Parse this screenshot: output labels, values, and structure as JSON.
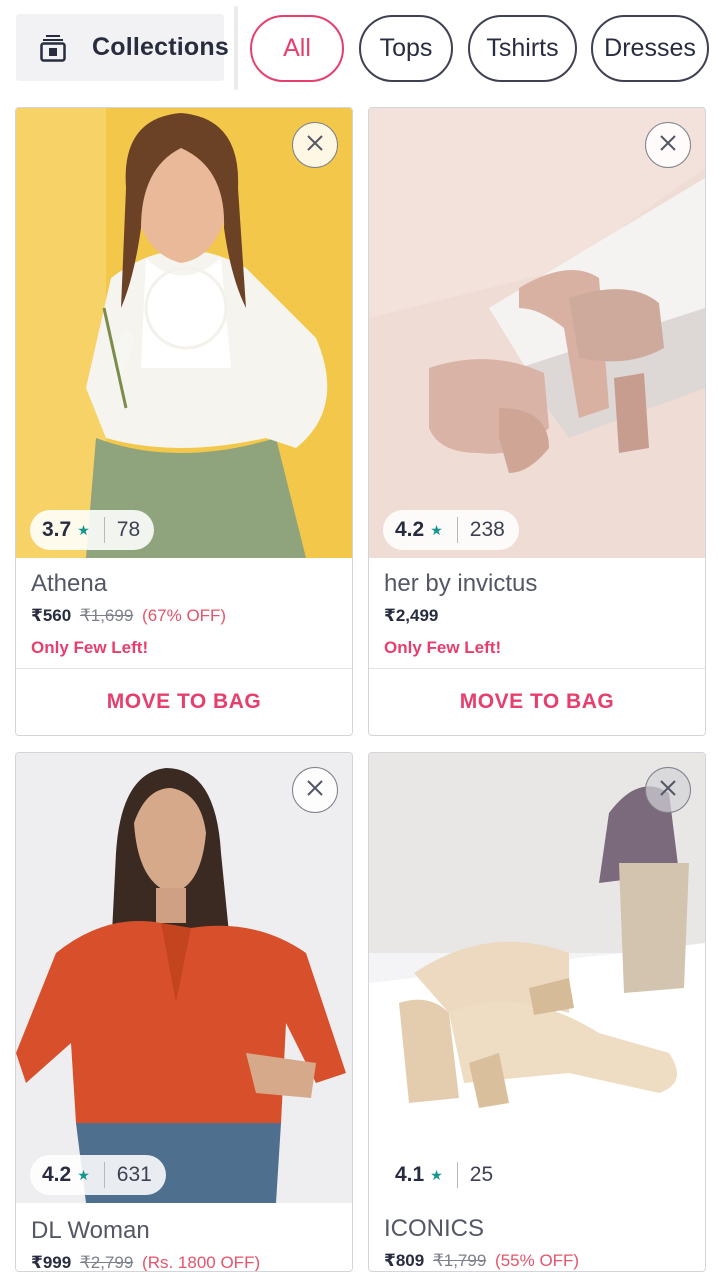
{
  "header": {
    "collections_label": "Collections",
    "filters": [
      {
        "label": "All",
        "active": true
      },
      {
        "label": "Tops",
        "active": false
      },
      {
        "label": "Tshirts",
        "active": false
      },
      {
        "label": "Dresses",
        "active": false
      }
    ]
  },
  "products": [
    {
      "brand": "Athena",
      "rating": "3.7",
      "rating_count": "78",
      "price": "₹560",
      "mrp": "₹1,699",
      "discount": "(67% OFF)",
      "stock": "Only Few Left!",
      "action": "MOVE TO BAG",
      "image": "woman-white-lace-top"
    },
    {
      "brand": "her by invictus",
      "rating": "4.2",
      "rating_count": "238",
      "price": "₹2,499",
      "mrp": "",
      "discount": "",
      "stock": "Only Few Left!",
      "action": "MOVE TO BAG",
      "image": "nude-block-heel-sandals"
    },
    {
      "brand": "DL Woman",
      "rating": "4.2",
      "rating_count": "631",
      "price": "₹999",
      "mrp": "₹2,799",
      "discount": "(Rs. 1800 OFF)",
      "stock": "",
      "action": "",
      "image": "woman-orange-shirt"
    },
    {
      "brand": "ICONICS",
      "rating": "4.1",
      "rating_count": "25",
      "price": "₹809",
      "mrp": "₹1,799",
      "discount": "(55% OFF)",
      "stock": "",
      "action": "",
      "image": "beige-strappy-heels"
    }
  ],
  "colors": {
    "accent": "#e63e6d",
    "rating_star": "#14958f",
    "text_primary": "#282c3f",
    "border": "#d4d5d9"
  },
  "icons": {
    "collections": "collection-icon",
    "remove": "close-icon",
    "star": "star-icon"
  }
}
